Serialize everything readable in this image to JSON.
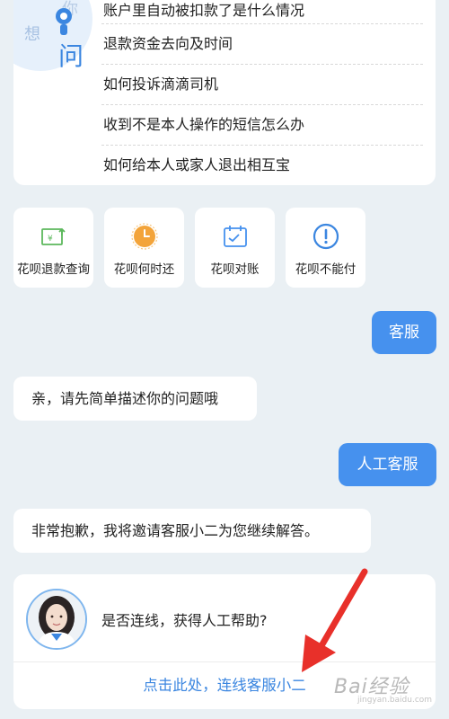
{
  "faq": {
    "mascot_chars": [
      "你",
      "想",
      "问"
    ],
    "items": [
      "账户里自动被扣款了是什么情况",
      "退款资金去向及时间",
      "如何投诉滴滴司机",
      "收到不是本人操作的短信怎么办",
      "如何给本人或家人退出相互宝"
    ]
  },
  "tiles": [
    {
      "label": "花呗退款查询",
      "icon": "refund-icon"
    },
    {
      "label": "花呗何时还",
      "icon": "clock-icon"
    },
    {
      "label": "花呗对账",
      "icon": "calendar-icon"
    },
    {
      "label": "花呗不能付",
      "icon": "alert-icon"
    }
  ],
  "chat": {
    "user_msg_1": "客服",
    "bot_msg_1": "亲，请先简单描述你的问题哦",
    "user_msg_2": "人工客服",
    "bot_msg_2": "非常抱歉，我将邀请客服小二为您继续解答。"
  },
  "connect": {
    "question": "是否连线，获得人工帮助?",
    "link": "点击此处，连线客服小二"
  },
  "watermark": {
    "text": "Bai经验",
    "sub": "jingyan.baidu.com"
  },
  "colors": {
    "accent": "#4691ee",
    "link": "#3b86e0",
    "background": "#eaf0f4",
    "arrow": "#e8302a"
  }
}
